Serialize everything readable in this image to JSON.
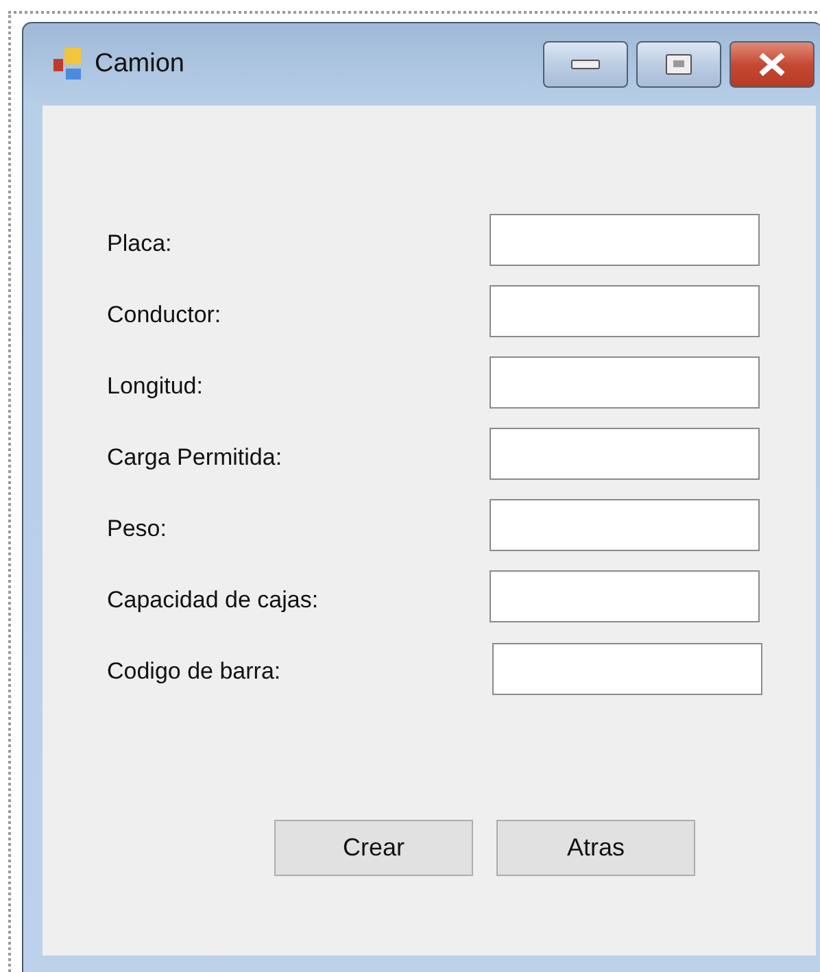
{
  "window": {
    "title": "Camion"
  },
  "fields": [
    {
      "label": "Placa:"
    },
    {
      "label": "Conductor:"
    },
    {
      "label": "Longitud:"
    },
    {
      "label": "Carga Permitida:"
    },
    {
      "label": "Peso:"
    },
    {
      "label": "Capacidad de cajas:"
    },
    {
      "label": "Codigo de barra:"
    }
  ],
  "buttons": [
    "Crear",
    "Atras"
  ]
}
